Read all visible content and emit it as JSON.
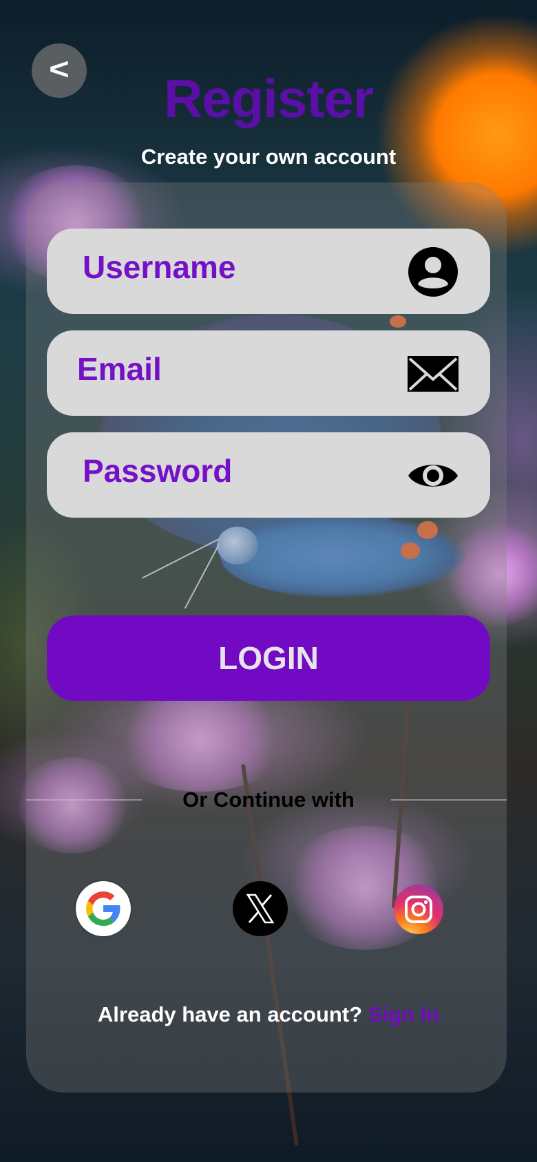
{
  "header": {
    "back_label": "<",
    "title": "Register",
    "subtitle": "Create your own account"
  },
  "form": {
    "username": {
      "label": "Username",
      "icon": "user-icon"
    },
    "email": {
      "label": "Email",
      "icon": "envelope-icon"
    },
    "password": {
      "label": "Password",
      "icon": "eye-icon"
    },
    "submit_label": "LOGIN"
  },
  "social": {
    "divider_text": "Or Continue with",
    "providers": [
      {
        "name": "google",
        "icon": "google-icon"
      },
      {
        "name": "x",
        "icon": "x-icon"
      },
      {
        "name": "instagram",
        "icon": "instagram-icon"
      }
    ]
  },
  "footer": {
    "prompt": "Already have an account?",
    "link_label": "Sign In"
  },
  "colors": {
    "brand_purple": "#720ac3",
    "title_purple": "#5a0fa6",
    "field_bg": "#d9d9d9"
  }
}
